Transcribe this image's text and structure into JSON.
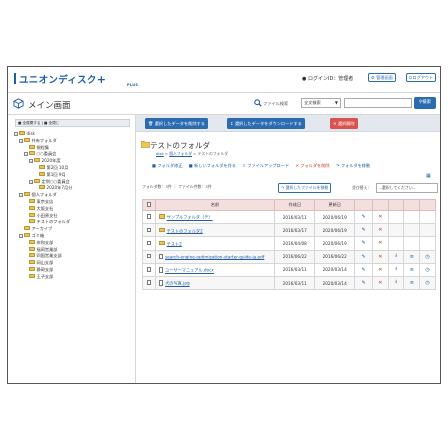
{
  "header": {
    "logo_text": "ユニオンディスク",
    "logo_plus": "+",
    "logo_sub": "PLUS",
    "login_text": "ログインID：管理者",
    "admin_button": "管理画面",
    "logout_button": "ログアウト"
  },
  "titlebar": {
    "page_title": "メイン画面",
    "search_label": "ファイル検索",
    "search_select_value": "全文検索",
    "search_button": "検索"
  },
  "left": {
    "tree_buttons": "■ 全展開する | ■ 全閉じ",
    "tree": [
      {
        "label": "disk",
        "indent": 0,
        "expander": "−"
      },
      {
        "label": "共有フォルダ",
        "indent": 1,
        "expander": "−"
      },
      {
        "label": "規程集",
        "indent": 2,
        "expander": ""
      },
      {
        "label": "○○委員会",
        "indent": 2,
        "expander": "−"
      },
      {
        "label": "2020年度",
        "indent": 3,
        "expander": "−"
      },
      {
        "label": "第2回 10月",
        "indent": 4,
        "expander": ""
      },
      {
        "label": "第1回 9月",
        "indent": 4,
        "expander": ""
      },
      {
        "label": "定例○○委員会",
        "indent": 3,
        "expander": "−"
      },
      {
        "label": "2020年7月分",
        "indent": 4,
        "expander": ""
      },
      {
        "label": "個人フォルダ",
        "indent": 1,
        "expander": "−"
      },
      {
        "label": "東京支店",
        "indent": 2,
        "expander": ""
      },
      {
        "label": "大阪支社",
        "indent": 2,
        "expander": ""
      },
      {
        "label": "小田原支社",
        "indent": 2,
        "expander": ""
      },
      {
        "label": "テストのフォルダ",
        "indent": 2,
        "expander": ""
      },
      {
        "label": "アーカイブ",
        "indent": 1,
        "expander": ""
      },
      {
        "label": "ゴミ箱",
        "indent": 1,
        "expander": "−"
      },
      {
        "label": "岸和支部",
        "indent": 2,
        "expander": ""
      },
      {
        "label": "福岡営業部",
        "indent": 2,
        "expander": ""
      },
      {
        "label": "四国営業支部",
        "indent": 2,
        "expander": ""
      },
      {
        "label": "岡山支部",
        "indent": 2,
        "expander": ""
      },
      {
        "label": "静岡支部",
        "indent": 2,
        "expander": ""
      },
      {
        "label": "王子支部",
        "indent": 2,
        "expander": ""
      }
    ]
  },
  "right": {
    "action_buttons": {
      "delete_selected": "選択したデータを削除する",
      "download_selected": "選択したデータをダウンロードする",
      "clear_selection": "選択解除"
    },
    "folder_title": "テストのフォルダ",
    "breadcrumb_root": "disk",
    "breadcrumb_mid": "個人フォルダ",
    "breadcrumb_current": "テストのフォルダ",
    "ops": {
      "edit_folder": "フォルダ修正",
      "new_folder": "新しいフォルダを作る",
      "upload": "ファイルアップロード",
      "delete_folder": "フォルダを削除",
      "move_folder": "フォルダを移動"
    },
    "info": "フォルダ数：3件 ｜ ファイル件数：3件",
    "move_files_button": "選択したファイルを移動",
    "sort_label": "並び替え：",
    "sort_value": "--選択してください--",
    "table": {
      "headers": [
        "",
        "名前",
        "作成日",
        "更新日"
      ],
      "rows": [
        {
          "type": "folder",
          "name": "サンプルフォルダ（テ）",
          "created": "2016/03/11",
          "updated": "2020/06/19",
          "actions": [
            "pen",
            "x"
          ]
        },
        {
          "type": "folder",
          "name": "テストのフォルダ2",
          "created": "2016/03/17",
          "updated": "2020/06/19",
          "actions": [
            "pen",
            "x"
          ]
        },
        {
          "type": "folder",
          "name": "テスト2",
          "created": "2016/04/08",
          "updated": "2020/06/19",
          "actions": [
            "pen",
            "x"
          ]
        },
        {
          "type": "file",
          "name": "search-engine-optimization-starter-guide-ja.pdf",
          "created": "2016/06/22",
          "updated": "2016/06/22",
          "actions": [
            "pen",
            "x",
            "dl",
            "wifi",
            "clock"
          ]
        },
        {
          "type": "file",
          "name": "ユーザーマニュアル.docx",
          "created": "2016/03/11",
          "updated": "2020/03/14",
          "actions": [
            "pen",
            "x",
            "dl",
            "wifi",
            "clock"
          ]
        },
        {
          "type": "file",
          "name": "犬の写真.jpg",
          "created": "2016/03/11",
          "updated": "2020/03/14",
          "actions": [
            "pen",
            "x",
            "dl",
            "wifi",
            "clock"
          ]
        }
      ]
    }
  },
  "colors": {
    "brand_blue": "#1f5ea8",
    "danger_red": "#d9534f",
    "table_header": "#f5dede"
  }
}
